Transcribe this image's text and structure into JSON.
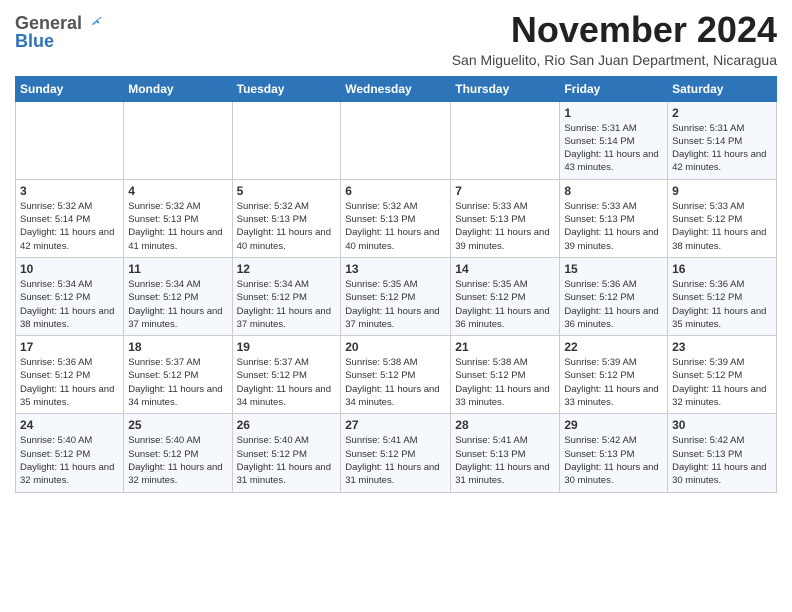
{
  "logo": {
    "general": "General",
    "blue": "Blue"
  },
  "header": {
    "month_title": "November 2024",
    "location": "San Miguelito, Rio San Juan Department, Nicaragua"
  },
  "days_of_week": [
    "Sunday",
    "Monday",
    "Tuesday",
    "Wednesday",
    "Thursday",
    "Friday",
    "Saturday"
  ],
  "weeks": [
    [
      {
        "day": "",
        "info": ""
      },
      {
        "day": "",
        "info": ""
      },
      {
        "day": "",
        "info": ""
      },
      {
        "day": "",
        "info": ""
      },
      {
        "day": "",
        "info": ""
      },
      {
        "day": "1",
        "info": "Sunrise: 5:31 AM\nSunset: 5:14 PM\nDaylight: 11 hours and 43 minutes."
      },
      {
        "day": "2",
        "info": "Sunrise: 5:31 AM\nSunset: 5:14 PM\nDaylight: 11 hours and 42 minutes."
      }
    ],
    [
      {
        "day": "3",
        "info": "Sunrise: 5:32 AM\nSunset: 5:14 PM\nDaylight: 11 hours and 42 minutes."
      },
      {
        "day": "4",
        "info": "Sunrise: 5:32 AM\nSunset: 5:13 PM\nDaylight: 11 hours and 41 minutes."
      },
      {
        "day": "5",
        "info": "Sunrise: 5:32 AM\nSunset: 5:13 PM\nDaylight: 11 hours and 40 minutes."
      },
      {
        "day": "6",
        "info": "Sunrise: 5:32 AM\nSunset: 5:13 PM\nDaylight: 11 hours and 40 minutes."
      },
      {
        "day": "7",
        "info": "Sunrise: 5:33 AM\nSunset: 5:13 PM\nDaylight: 11 hours and 39 minutes."
      },
      {
        "day": "8",
        "info": "Sunrise: 5:33 AM\nSunset: 5:13 PM\nDaylight: 11 hours and 39 minutes."
      },
      {
        "day": "9",
        "info": "Sunrise: 5:33 AM\nSunset: 5:12 PM\nDaylight: 11 hours and 38 minutes."
      }
    ],
    [
      {
        "day": "10",
        "info": "Sunrise: 5:34 AM\nSunset: 5:12 PM\nDaylight: 11 hours and 38 minutes."
      },
      {
        "day": "11",
        "info": "Sunrise: 5:34 AM\nSunset: 5:12 PM\nDaylight: 11 hours and 37 minutes."
      },
      {
        "day": "12",
        "info": "Sunrise: 5:34 AM\nSunset: 5:12 PM\nDaylight: 11 hours and 37 minutes."
      },
      {
        "day": "13",
        "info": "Sunrise: 5:35 AM\nSunset: 5:12 PM\nDaylight: 11 hours and 37 minutes."
      },
      {
        "day": "14",
        "info": "Sunrise: 5:35 AM\nSunset: 5:12 PM\nDaylight: 11 hours and 36 minutes."
      },
      {
        "day": "15",
        "info": "Sunrise: 5:36 AM\nSunset: 5:12 PM\nDaylight: 11 hours and 36 minutes."
      },
      {
        "day": "16",
        "info": "Sunrise: 5:36 AM\nSunset: 5:12 PM\nDaylight: 11 hours and 35 minutes."
      }
    ],
    [
      {
        "day": "17",
        "info": "Sunrise: 5:36 AM\nSunset: 5:12 PM\nDaylight: 11 hours and 35 minutes."
      },
      {
        "day": "18",
        "info": "Sunrise: 5:37 AM\nSunset: 5:12 PM\nDaylight: 11 hours and 34 minutes."
      },
      {
        "day": "19",
        "info": "Sunrise: 5:37 AM\nSunset: 5:12 PM\nDaylight: 11 hours and 34 minutes."
      },
      {
        "day": "20",
        "info": "Sunrise: 5:38 AM\nSunset: 5:12 PM\nDaylight: 11 hours and 34 minutes."
      },
      {
        "day": "21",
        "info": "Sunrise: 5:38 AM\nSunset: 5:12 PM\nDaylight: 11 hours and 33 minutes."
      },
      {
        "day": "22",
        "info": "Sunrise: 5:39 AM\nSunset: 5:12 PM\nDaylight: 11 hours and 33 minutes."
      },
      {
        "day": "23",
        "info": "Sunrise: 5:39 AM\nSunset: 5:12 PM\nDaylight: 11 hours and 32 minutes."
      }
    ],
    [
      {
        "day": "24",
        "info": "Sunrise: 5:40 AM\nSunset: 5:12 PM\nDaylight: 11 hours and 32 minutes."
      },
      {
        "day": "25",
        "info": "Sunrise: 5:40 AM\nSunset: 5:12 PM\nDaylight: 11 hours and 32 minutes."
      },
      {
        "day": "26",
        "info": "Sunrise: 5:40 AM\nSunset: 5:12 PM\nDaylight: 11 hours and 31 minutes."
      },
      {
        "day": "27",
        "info": "Sunrise: 5:41 AM\nSunset: 5:12 PM\nDaylight: 11 hours and 31 minutes."
      },
      {
        "day": "28",
        "info": "Sunrise: 5:41 AM\nSunset: 5:13 PM\nDaylight: 11 hours and 31 minutes."
      },
      {
        "day": "29",
        "info": "Sunrise: 5:42 AM\nSunset: 5:13 PM\nDaylight: 11 hours and 30 minutes."
      },
      {
        "day": "30",
        "info": "Sunrise: 5:42 AM\nSunset: 5:13 PM\nDaylight: 11 hours and 30 minutes."
      }
    ]
  ]
}
